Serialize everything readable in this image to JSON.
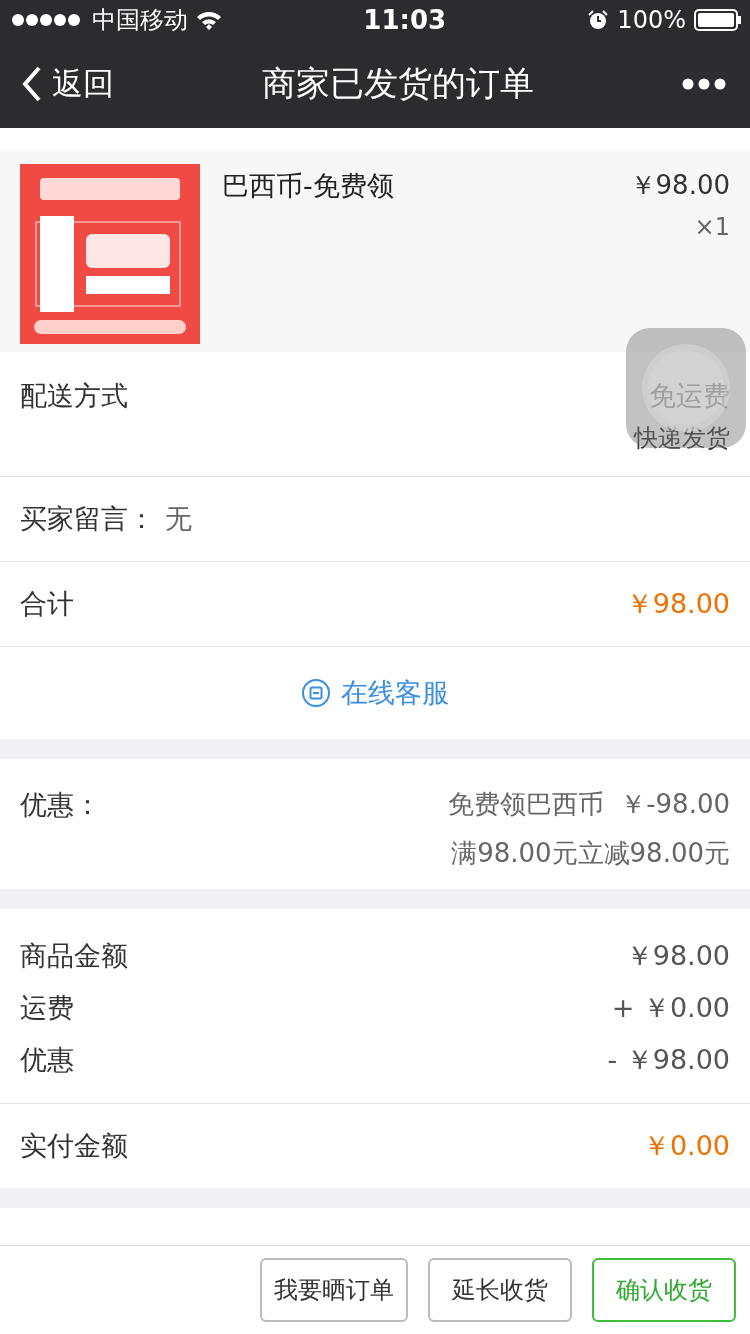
{
  "status_bar": {
    "carrier": "中国移动",
    "time": "11:03",
    "battery": "100%"
  },
  "nav": {
    "back": "返回",
    "title": "商家已发货的订单"
  },
  "product": {
    "name": "巴西币-免费领",
    "price": "￥98.00",
    "quantity": "×1"
  },
  "delivery": {
    "label": "配送方式",
    "values": [
      "免运费",
      "快递发货"
    ]
  },
  "message": {
    "label": "买家留言：",
    "value": "无"
  },
  "total": {
    "label": "合计",
    "value": "￥98.00"
  },
  "service": {
    "label": "在线客服"
  },
  "discount": {
    "label": "优惠：",
    "lines": [
      "免费领巴西币  ￥-98.00",
      "满98.00元立减98.00元"
    ]
  },
  "amounts": [
    {
      "label": "商品金额",
      "value": "￥98.00"
    },
    {
      "label": "运费",
      "value": "+ ￥0.00"
    },
    {
      "label": "优惠",
      "value": "- ￥98.00"
    }
  ],
  "paid": {
    "label": "实付金额",
    "value": "￥0.00"
  },
  "buttons": [
    {
      "label": "我要晒订单",
      "kind": "default"
    },
    {
      "label": "延长收货",
      "kind": "default"
    },
    {
      "label": "确认收货",
      "kind": "primary"
    }
  ]
}
